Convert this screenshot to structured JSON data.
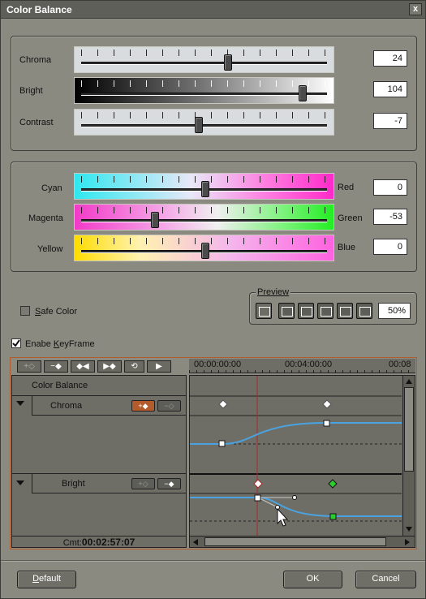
{
  "window": {
    "title": "Color Balance",
    "close_glyph": "x"
  },
  "tone": {
    "chroma": {
      "label": "Chroma",
      "value": "24",
      "level": 0.6
    },
    "bright": {
      "label": "Bright",
      "value": "104",
      "level": 0.9
    },
    "contrast": {
      "label": "Contrast",
      "value": "-7",
      "level": 0.47
    }
  },
  "color": {
    "cyan_red": {
      "left": "Cyan",
      "right": "Red",
      "value": "0",
      "level": 0.5
    },
    "magenta_green": {
      "left": "Magenta",
      "right": "Green",
      "value": "-53",
      "level": 0.31
    },
    "yellow_blue": {
      "left": "Yellow",
      "right": "Blue",
      "value": "0",
      "level": 0.5
    }
  },
  "safe_color": {
    "label_u": "S",
    "label_rest": "afe Color",
    "checked": false
  },
  "preview": {
    "title": "Preview",
    "zoom": "50%"
  },
  "keyframe": {
    "label_pre": "Enabe ",
    "label_u": "K",
    "label_rest": "eyFrame",
    "checked": true
  },
  "timeline": {
    "times": [
      "00:00:00:00",
      "00:04:00:00",
      "00:08"
    ],
    "header": "Color Balance",
    "tracks": [
      {
        "name": "Chroma"
      },
      {
        "name": "Bright"
      }
    ],
    "current_label": "Cmt:",
    "current_time": "00:02:57:07"
  },
  "buttons": {
    "default_u": "D",
    "default_rest": "efault",
    "ok": "OK",
    "cancel": "Cancel"
  },
  "colors": {
    "accent": "#b35b2a",
    "curve": "#4aa3e0",
    "playhead": "#a52a2a"
  }
}
